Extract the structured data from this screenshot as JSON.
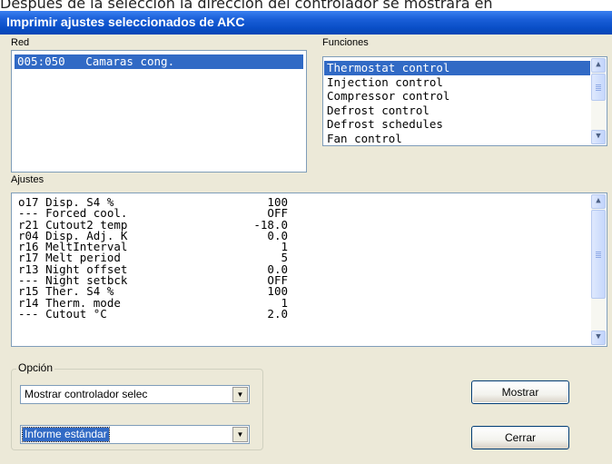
{
  "document_text": "Después de la selección la dirección del controlador se mostrará en",
  "window": {
    "title": "Imprimir ajustes seleccionados de AKC"
  },
  "red": {
    "label": "Red",
    "items": [
      {
        "text": "005:050   Camaras cong.",
        "selected": true
      }
    ]
  },
  "funciones": {
    "label": "Funciones",
    "items": [
      {
        "text": "Thermostat control",
        "selected": true
      },
      {
        "text": "Injection control",
        "selected": false
      },
      {
        "text": "Compressor control",
        "selected": false
      },
      {
        "text": "Defrost control",
        "selected": false
      },
      {
        "text": "Defrost schedules",
        "selected": false
      },
      {
        "text": "Fan control",
        "selected": false
      }
    ]
  },
  "ajustes": {
    "label": "Ajustes",
    "rows": [
      {
        "param": "o17 Disp. S4 %",
        "value": "100"
      },
      {
        "param": "--- Forced cool.",
        "value": "OFF"
      },
      {
        "param": "r21 Cutout2 temp",
        "value": "-18.0"
      },
      {
        "param": "r04 Disp. Adj. K",
        "value": "0.0"
      },
      {
        "param": "r16 MeltInterval",
        "value": "1"
      },
      {
        "param": "r17 Melt period",
        "value": "5"
      },
      {
        "param": "r13 Night offset",
        "value": "0.0"
      },
      {
        "param": "--- Night setbck",
        "value": "OFF"
      },
      {
        "param": "r15 Ther. S4 %",
        "value": "100"
      },
      {
        "param": "r14 Therm. mode",
        "value": "1"
      },
      {
        "param": "--- Cutout °C",
        "value": "2.0"
      }
    ]
  },
  "opcion": {
    "label": "Opción",
    "combo1": "Mostrar controlador selec",
    "combo2": "Informe estándar"
  },
  "buttons": {
    "mostrar": "Mostrar",
    "cerrar": "Cerrar"
  },
  "colors": {
    "title_bar": "#0a4fc8",
    "selection": "#316ac5",
    "dialog_bg": "#ece9d8"
  }
}
